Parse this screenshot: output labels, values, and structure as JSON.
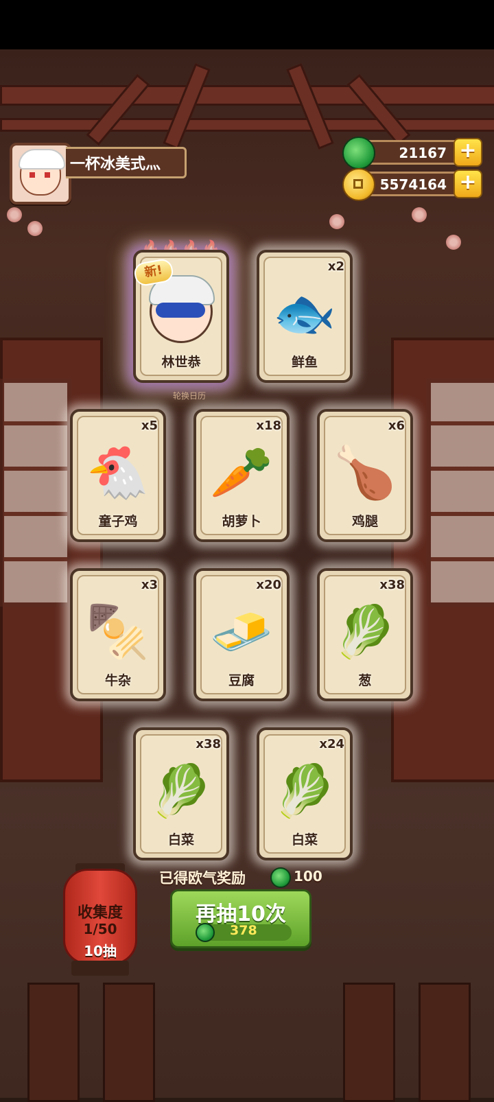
{
  "player": {
    "name": "一杯冰美式灬"
  },
  "currency": {
    "jade": {
      "icon": "jade-icon",
      "value": "21167"
    },
    "gold": {
      "icon": "coin-icon",
      "value": "5574164"
    }
  },
  "hero_card": {
    "badge": "新!",
    "name": "林世恭",
    "stars": 5
  },
  "sign_text": "轮换日历",
  "cards": [
    {
      "name": "鲜鱼",
      "count": "x2",
      "art": "🐟"
    },
    {
      "name": "童子鸡",
      "count": "x5",
      "art": "🐔"
    },
    {
      "name": "胡萝卜",
      "count": "x18",
      "art": "🥕"
    },
    {
      "name": "鸡腿",
      "count": "x6",
      "art": "🍗"
    },
    {
      "name": "牛杂",
      "count": "x3",
      "art": "🍢"
    },
    {
      "name": "豆腐",
      "count": "x20",
      "art": "🧈"
    },
    {
      "name": "葱",
      "count": "x38",
      "art": "🥬"
    },
    {
      "name": "白菜",
      "count": "x38",
      "art": "🥬"
    },
    {
      "name": "白菜",
      "count": "x24",
      "art": "🥬"
    }
  ],
  "reward": {
    "label": "已得欧气奖励",
    "value": "100"
  },
  "draw_button": {
    "label": "再抽10次",
    "cost": "378"
  },
  "collection": {
    "title": "收集度",
    "progress": "1/50",
    "draws": "10抽"
  },
  "colors": {
    "jade": "#1f9a3a",
    "gold": "#f2b92a",
    "button_green": "#5ea22a",
    "lantern_red": "#e0483a"
  }
}
